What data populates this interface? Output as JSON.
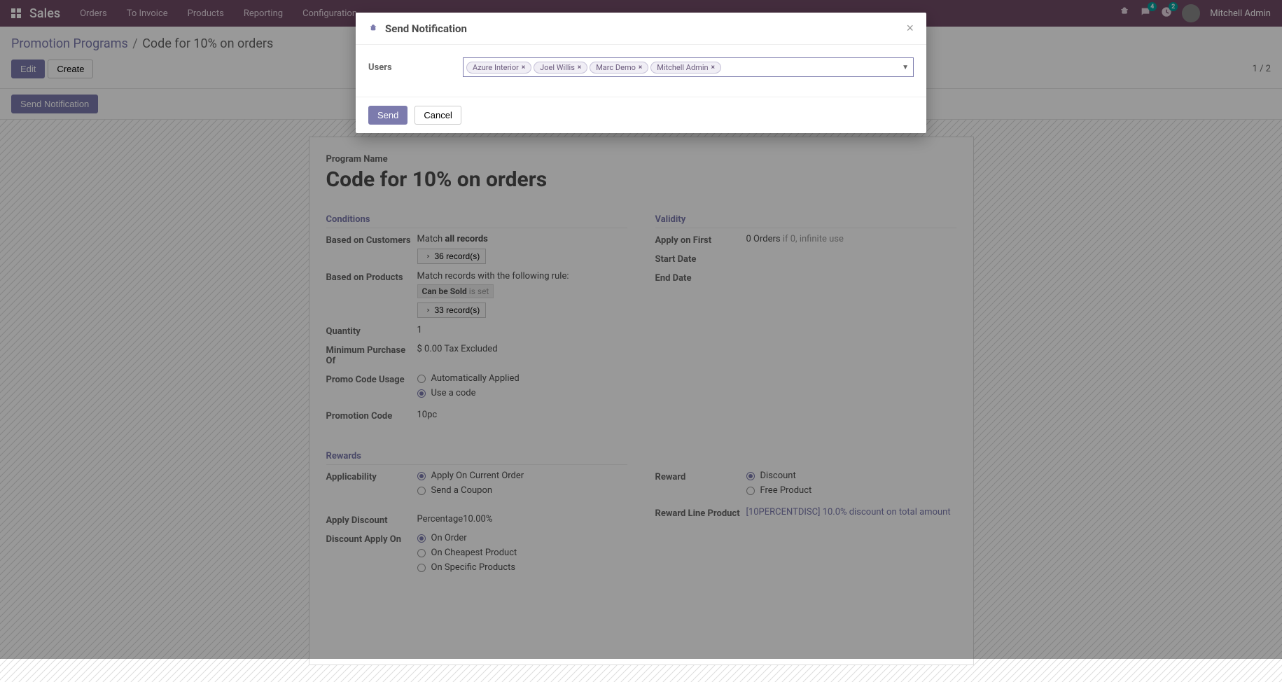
{
  "navbar": {
    "brand": "Sales",
    "menu": [
      "Orders",
      "To Invoice",
      "Products",
      "Reporting",
      "Configuration"
    ],
    "messages_badge": "4",
    "activities_badge": "2",
    "user": "Mitchell Admin"
  },
  "breadcrumb": {
    "page": "Promotion Programs",
    "current": "Code for 10% on orders"
  },
  "buttons": {
    "edit": "Edit",
    "create": "Create",
    "send_notification": "Send Notification"
  },
  "pager": "1 / 2",
  "form": {
    "program_name_label": "Program Name",
    "program_name": "Code for 10% on orders",
    "conditions": {
      "title": "Conditions",
      "based_on_customers_label": "Based on Customers",
      "based_on_customers_value": "Match ",
      "based_on_customers_bold": "all records",
      "records_36": "36 record(s)",
      "based_on_products_label": "Based on Products",
      "based_on_products_value": "Match records with the following rule:",
      "can_be_sold": "Can be Sold",
      "is_set": "is set",
      "records_33": "33 record(s)",
      "quantity_label": "Quantity",
      "quantity_value": "1",
      "min_purchase_label": "Minimum Purchase Of",
      "min_purchase_value": "$ 0.00 Tax Excluded",
      "promo_code_usage_label": "Promo Code Usage",
      "promo_auto": "Automatically Applied",
      "promo_code": "Use a code",
      "promotion_code_label": "Promotion Code",
      "promotion_code_value": "10pc"
    },
    "validity": {
      "title": "Validity",
      "apply_first_label": "Apply on First",
      "apply_first_value": "0 Orders",
      "apply_first_hint": "if 0, infinite use",
      "start_date_label": "Start Date",
      "end_date_label": "End Date"
    },
    "rewards": {
      "title": "Rewards",
      "applicability_label": "Applicability",
      "apply_current": "Apply On Current Order",
      "send_coupon": "Send a Coupon",
      "reward_label": "Reward",
      "discount": "Discount",
      "free_product": "Free Product",
      "reward_line_label": "Reward Line Product",
      "reward_line_value": "[10PERCENTDISC] 10.0% discount on total amount",
      "apply_discount_label": "Apply Discount",
      "apply_discount_value": "Percentage10.00%",
      "discount_apply_on_label": "Discount Apply On",
      "on_order": "On Order",
      "on_cheapest": "On Cheapest Product",
      "on_specific": "On Specific Products"
    }
  },
  "modal": {
    "title": "Send Notification",
    "users_label": "Users",
    "chips": [
      "Azure Interior",
      "Joel Willis",
      "Marc Demo",
      "Mitchell Admin"
    ],
    "send": "Send",
    "cancel": "Cancel"
  }
}
